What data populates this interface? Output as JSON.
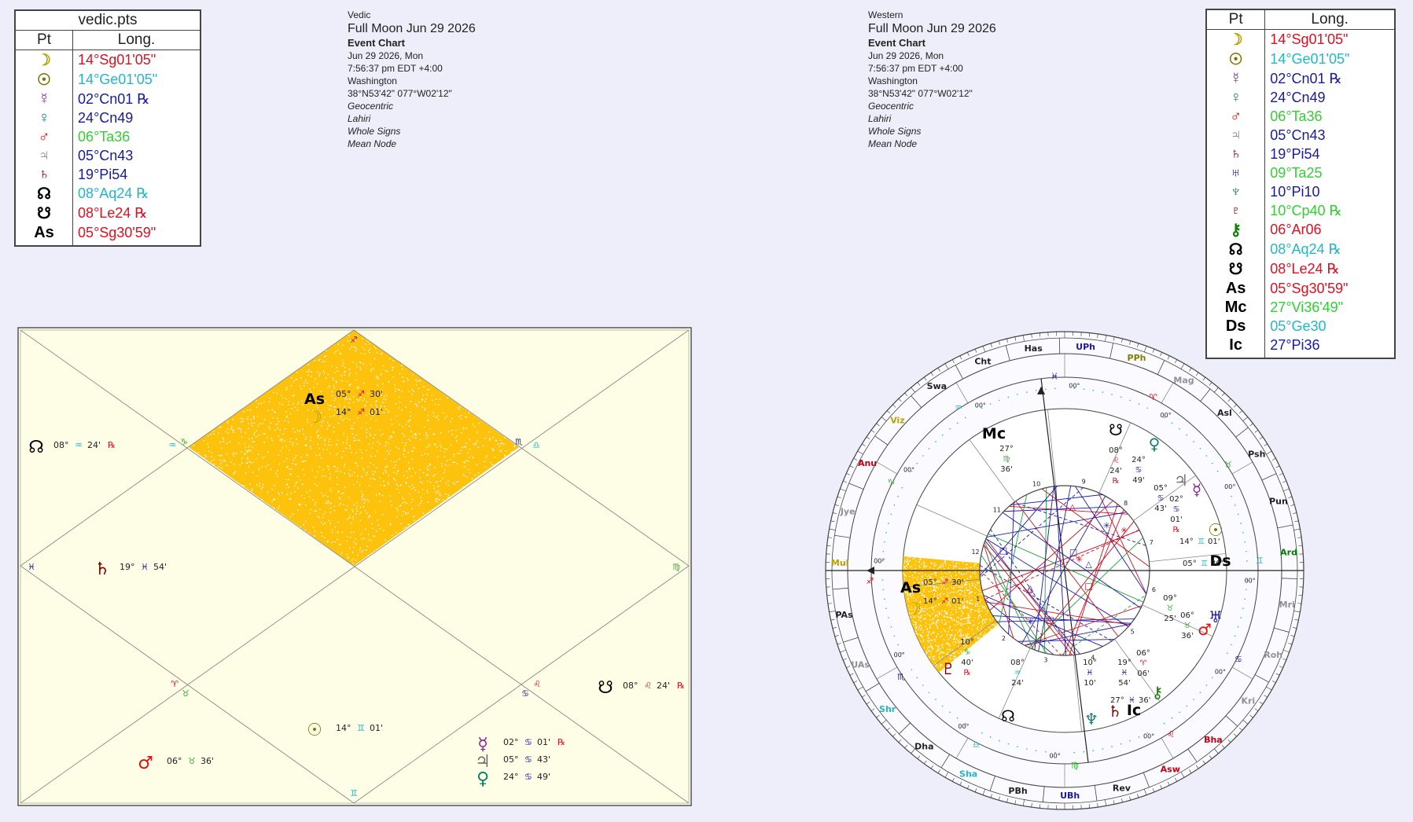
{
  "vedic_table": {
    "title": "vedic.pts",
    "col_pt": "Pt",
    "col_long": "Long.",
    "rows": [
      {
        "glyph": "☽",
        "value": "14°Sg01'05\"",
        "color": "#e01020",
        "gcolor": "#b8a000"
      },
      {
        "glyph": "☉",
        "value": "14°Ge01'05\"",
        "color": "#20b8c8",
        "gcolor": "#807000"
      },
      {
        "glyph": "☿",
        "value": "02°Cn01 ℞",
        "color": "#1a1aa0",
        "gcolor": "#902090"
      },
      {
        "glyph": "♀",
        "value": "24°Cn49",
        "color": "#1a1aa0",
        "gcolor": "#108070"
      },
      {
        "glyph": "♂",
        "value": "06°Ta36",
        "color": "#30d030",
        "gcolor": "#e01010"
      },
      {
        "glyph": "♃",
        "value": "05°Cn43",
        "color": "#1a1aa0",
        "gcolor": "#707070"
      },
      {
        "glyph": "♄",
        "value": "19°Pi54",
        "color": "#1a1aa0",
        "gcolor": "#800000"
      },
      {
        "glyph": "☊",
        "value": "08°Aq24 ℞",
        "color": "#20b8c8",
        "gcolor": "#000000"
      },
      {
        "glyph": "☋",
        "value": "08°Le24 ℞",
        "color": "#e01020",
        "gcolor": "#000000"
      },
      {
        "glyph": "As",
        "value": "05°Sg30'59\"",
        "color": "#e01020",
        "gcolor": "#000000"
      }
    ]
  },
  "western_table": {
    "col_pt": "Pt",
    "col_long": "Long.",
    "rows": [
      {
        "glyph": "☽",
        "value": "14°Sg01'05\"",
        "color": "#e01020",
        "gcolor": "#b8a000"
      },
      {
        "glyph": "☉",
        "value": "14°Ge01'05\"",
        "color": "#20b8c8",
        "gcolor": "#807000"
      },
      {
        "glyph": "☿",
        "value": "02°Cn01 ℞",
        "color": "#1a1aa0",
        "gcolor": "#902090"
      },
      {
        "glyph": "♀",
        "value": "24°Cn49",
        "color": "#1a1aa0",
        "gcolor": "#108070"
      },
      {
        "glyph": "♂",
        "value": "06°Ta36",
        "color": "#30d030",
        "gcolor": "#e01010"
      },
      {
        "glyph": "♃",
        "value": "05°Cn43",
        "color": "#1a1aa0",
        "gcolor": "#707070"
      },
      {
        "glyph": "♄",
        "value": "19°Pi54",
        "color": "#1a1aa0",
        "gcolor": "#800000"
      },
      {
        "glyph": "♅",
        "value": "09°Ta25",
        "color": "#30d030",
        "gcolor": "#1a1ab0"
      },
      {
        "glyph": "♆",
        "value": "10°Pi10",
        "color": "#1a1aa0",
        "gcolor": "#108070"
      },
      {
        "glyph": "♇",
        "value": "10°Cp40 ℞",
        "color": "#30d030",
        "gcolor": "#800000"
      },
      {
        "glyph": "⚷",
        "value": "06°Ar06",
        "color": "#e01020",
        "gcolor": "#108000"
      },
      {
        "glyph": "☊",
        "value": "08°Aq24 ℞",
        "color": "#20b8c8",
        "gcolor": "#000000"
      },
      {
        "glyph": "☋",
        "value": "08°Le24 ℞",
        "color": "#e01020",
        "gcolor": "#000000"
      },
      {
        "glyph": "As",
        "value": "05°Sg30'59\"",
        "color": "#e01020",
        "gcolor": "#000000"
      },
      {
        "glyph": "Mc",
        "value": "27°Vi36'49\"",
        "color": "#30d030",
        "gcolor": "#000000"
      },
      {
        "glyph": "Ds",
        "value": "05°Ge30",
        "color": "#20b8c8",
        "gcolor": "#000000"
      },
      {
        "glyph": "Ic",
        "value": "27°Pi36",
        "color": "#1a1aa0",
        "gcolor": "#000000"
      }
    ]
  },
  "vedic_info": {
    "system": "Vedic",
    "title": "Full Moon Jun 29 2026",
    "type": "Event Chart",
    "date": "Jun 29 2026, Mon",
    "time": "7:56:37 pm  EDT +4:00",
    "place": "Washington",
    "coords": "38°N53'42\" 077°W02'12\"",
    "opt1": "Geocentric",
    "opt2": "Lahiri",
    "opt3": "Whole Signs",
    "opt4": "Mean Node"
  },
  "western_info": {
    "system": "Western",
    "title": "Full Moon Jun 29 2026",
    "type": "Event Chart",
    "date": "Jun 29 2026, Mon",
    "time": "7:56:37 pm  EDT +4:00",
    "place": "Washington",
    "coords": "38°N53'42\" 077°W02'12\"",
    "opt1": "Geocentric",
    "opt2": "Lahiri",
    "opt3": "Whole Signs",
    "opt4": "Mean Node"
  },
  "colors": {
    "highlight": "#fcc20c",
    "chart_bg": "#fefee6",
    "fire": "#e01020",
    "earth": "#30b030",
    "air": "#20b8c8",
    "water": "#1a1aa0"
  },
  "vedic_chart": {
    "sign_marks": {
      "h1_top": "♐",
      "h2a": "♑",
      "h2b": "♒",
      "h12": "♏",
      "h11": "♎",
      "h3": "♓",
      "h10": "♍",
      "h4a": "♈",
      "h4b": "♉",
      "h6": "♋",
      "h5": "♌",
      "h7": "♊"
    },
    "planets": {
      "asc": {
        "glyph": "As",
        "deg": "05°",
        "sign": "♐",
        "min": "30'"
      },
      "moon": {
        "glyph": "☽",
        "deg": "14°",
        "sign": "♐",
        "min": "01'"
      },
      "node": {
        "glyph": "☊",
        "deg": "08°",
        "sign": "♒",
        "min": "24'",
        "rx": "℞"
      },
      "saturn": {
        "glyph": "♄",
        "deg": "19°",
        "sign": "♓",
        "min": "54'"
      },
      "ketu": {
        "glyph": "☋",
        "deg": "08°",
        "sign": "♌",
        "min": "24'",
        "rx": "℞"
      },
      "sun": {
        "glyph": "☉",
        "deg": "14°",
        "sign": "♊",
        "min": "01'"
      },
      "mercury": {
        "glyph": "☿",
        "deg": "02°",
        "sign": "♋",
        "min": "01'",
        "rx": "℞"
      },
      "jupiter": {
        "glyph": "♃",
        "deg": "05°",
        "sign": "♋",
        "min": "43'"
      },
      "venus": {
        "glyph": "♀",
        "deg": "24°",
        "sign": "♋",
        "min": "49'"
      },
      "mars": {
        "glyph": "♂",
        "deg": "06°",
        "sign": "♉",
        "min": "36'"
      }
    }
  },
  "western_chart": {
    "nakshatras": [
      "Has",
      "UPh",
      "PPh",
      "Mag",
      "Asl",
      "Psh",
      "Pun",
      "Ard",
      "Mri",
      "Roh",
      "Kri",
      "Bha",
      "Asw",
      "Rev",
      "UBh",
      "PBh",
      "Sha",
      "Dha",
      "Shr",
      "UAs",
      "PAs",
      "Mul",
      "Jye",
      "Anu",
      "Viz",
      "Swa",
      "Cht"
    ],
    "house_numbers": [
      "1",
      "2",
      "3",
      "4",
      "5",
      "6",
      "7",
      "8",
      "9",
      "10",
      "11",
      "12"
    ],
    "sign_glyphs": [
      "♈",
      "♉",
      "♊",
      "♋",
      "♌",
      "♍",
      "♎",
      "♏",
      "♐",
      "♑",
      "♒",
      "♓"
    ],
    "cusp_degree": "00°",
    "angles": {
      "asc": {
        "glyph": "As",
        "deg": "05°",
        "sign": "♐",
        "min": "30'"
      },
      "mc": {
        "glyph": "Mc",
        "deg": "27°",
        "sign": "♍",
        "min": "36'"
      },
      "ds": {
        "glyph": "Ds",
        "deg": "05°",
        "sign": "♊",
        "min": "30'"
      },
      "ic": {
        "glyph": "Ic",
        "deg": "27°",
        "sign": "♓",
        "min": "36'"
      }
    },
    "planets": {
      "moon": {
        "glyph": "☽",
        "deg": "14°",
        "sign": "♐",
        "min": "01'"
      },
      "sun": {
        "glyph": "☉",
        "deg": "14°",
        "sign": "♊",
        "min": "01'"
      },
      "mercury": {
        "glyph": "☿",
        "deg": "02°",
        "sign": "♋",
        "min": "01'",
        "rx": "℞"
      },
      "venus": {
        "glyph": "♀",
        "deg": "24°",
        "sign": "♋",
        "min": "49'"
      },
      "jupiter": {
        "glyph": "♃",
        "deg": "05°",
        "sign": "♋",
        "min": "43'"
      },
      "node": {
        "glyph": "☋",
        "deg": "08°",
        "sign": "♌",
        "min": "24'",
        "rx": "℞"
      },
      "uranus": {
        "glyph": "♅",
        "deg": "09°",
        "sign": "♉",
        "min": "25'"
      },
      "mars": {
        "glyph": "♂",
        "deg": "06°",
        "sign": "♉",
        "min": "36'"
      },
      "chiron": {
        "glyph": "⚷",
        "deg": "06°",
        "sign": "♈",
        "min": "06'"
      },
      "saturn": {
        "glyph": "♄",
        "deg": "19°",
        "sign": "♓",
        "min": "54'"
      },
      "neptune": {
        "glyph": "♆",
        "deg": "10°",
        "sign": "♓",
        "min": "10'"
      },
      "southnode": {
        "glyph": "☊",
        "deg": "08°",
        "sign": "♒",
        "min": "24'"
      },
      "pluto": {
        "glyph": "♇",
        "deg": "10°",
        "sign": "♑",
        "min": "40'",
        "rx": "℞"
      }
    }
  }
}
